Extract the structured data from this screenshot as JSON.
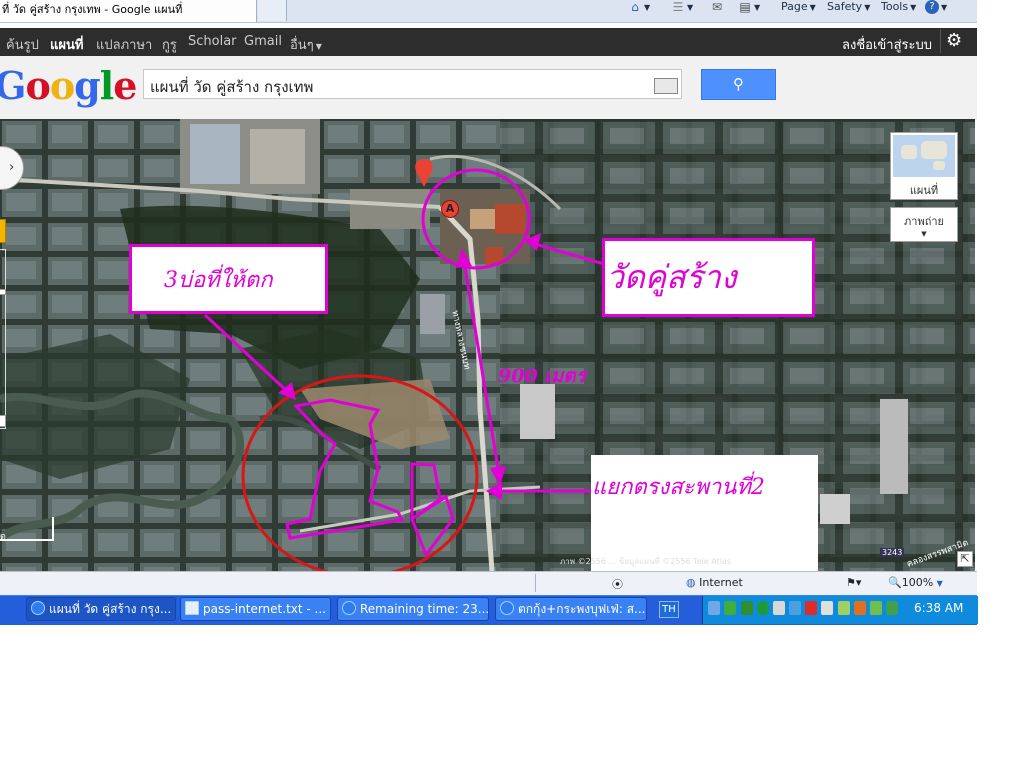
{
  "browser": {
    "tab_title": "ที่ วัด คู่สร้าง กรุงเทพ - Google แผนที่",
    "commands": {
      "page": "Page",
      "safety": "Safety",
      "tools": "Tools"
    }
  },
  "google_bar": {
    "items": [
      "ค้นรูป",
      "แผนที่",
      "แปลภาษา",
      "กูรู",
      "Scholar",
      "Gmail",
      "อื่นๆ"
    ],
    "signin": "ลงชื่อเข้าสู่ระบบ"
  },
  "logo": {
    "letters": [
      "G",
      "o",
      "o",
      "g",
      "l",
      "e"
    ],
    "colors": [
      "#3369e8",
      "#d50f25",
      "#eeb211",
      "#3369e8",
      "#009925",
      "#d50f25"
    ]
  },
  "search": {
    "query": "แผนที่ วัด คู่สร้าง กรุงเทพ"
  },
  "map": {
    "map_type_label": "แผนที่",
    "satellite_label": "ภาพถ่าย",
    "attribution": "ภาพ ©2556 ... ข้อมูลแผนที่ ©2556 Tele Atlas",
    "road_label_1": "ทางหลวงชนบท",
    "road_label_2": "คลองสรรพสามิต",
    "road_shield": "3243",
    "scale_label": "ต",
    "marker_letter": "A"
  },
  "annotations": {
    "ponds_label": "3บ่อที่ให้ตก",
    "temple_label": "วัดคู่สร้าง",
    "distance_label": "900 เมตร",
    "junction_label": "แยกตรงสะพานที่2"
  },
  "status_bar": {
    "zone": "Internet",
    "zoom": "100%"
  },
  "taskbar": {
    "tasks": [
      "แผนที่ วัด คู่สร้าง กรุง...",
      "pass-internet.txt - ...",
      "Remaining time: 23...",
      "ตกกุ้ง+กระพงบุฟเฟ่: ส..."
    ],
    "lang": "TH",
    "clock": "6:38 AM"
  }
}
